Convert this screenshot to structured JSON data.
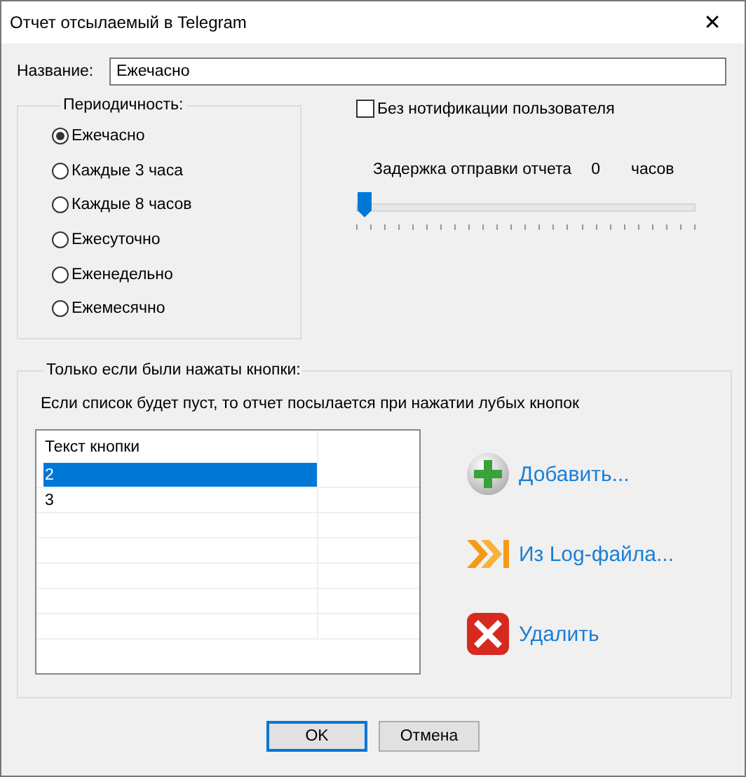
{
  "window": {
    "title": "Отчет отсылаемый в Telegram",
    "close": "✕"
  },
  "name_field": {
    "label": "Название:",
    "value": "Ежечасно"
  },
  "periodicity": {
    "title": "Периодичность:",
    "options": [
      {
        "label": "Ежечасно",
        "selected": true
      },
      {
        "label": "Каждые 3 часа",
        "selected": false
      },
      {
        "label": "Каждые 8 часов",
        "selected": false
      },
      {
        "label": "Ежесуточно",
        "selected": false
      },
      {
        "label": "Еженедельно",
        "selected": false
      },
      {
        "label": "Ежемесячно",
        "selected": false
      }
    ]
  },
  "no_notification": {
    "label": "Без нотификации пользователя",
    "checked": false
  },
  "delay": {
    "label": "Задержка отправки отчета",
    "value": "0",
    "unit": "часов",
    "level": 0
  },
  "buttons_group": {
    "title": "Только если были нажаты кнопки:",
    "hint": "Если список будет пуст, то отчет посылается при нажатии лубых кнопок",
    "table": {
      "columns": [
        "Текст кнопки"
      ],
      "rows": [
        {
          "text": "2",
          "selected": true
        },
        {
          "text": "3",
          "selected": false
        }
      ]
    },
    "actions": [
      {
        "kind": "add",
        "label": "Добавить..."
      },
      {
        "kind": "log",
        "label": "Из Log-файла..."
      },
      {
        "kind": "delete",
        "label": "Удалить"
      }
    ]
  },
  "footer": [
    {
      "label": "OK",
      "default": true
    },
    {
      "label": "Отмена",
      "default": false
    }
  ]
}
